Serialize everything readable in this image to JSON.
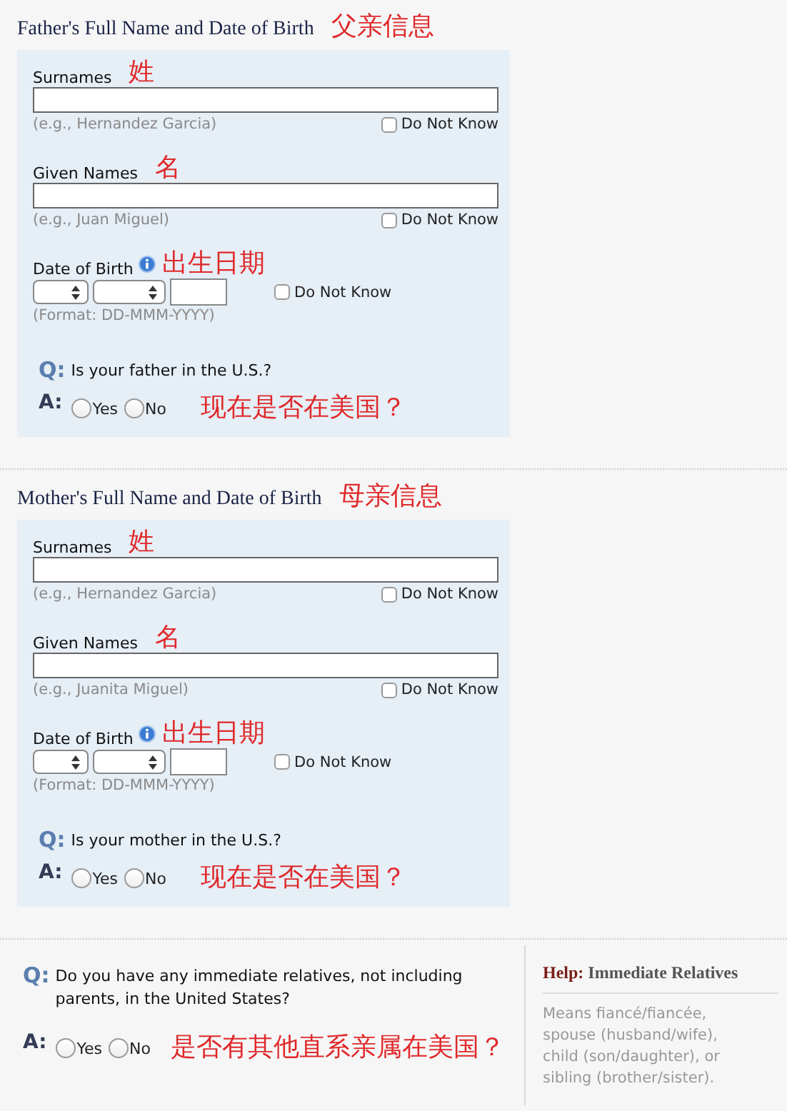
{
  "sections": [
    {
      "heading": "Father's Full Name and Date of Birth",
      "note": "父亲信息",
      "fields": [
        {
          "kind": "text",
          "label": "Surnames",
          "note": "姓",
          "hint": "(e.g., Hernandez Garcia)",
          "checkbox": {
            "label": "Do Not Know",
            "checked": false
          }
        },
        {
          "kind": "text",
          "label": "Given Names",
          "note": "名",
          "hint": "(e.g., Juan Miguel)",
          "checkbox": {
            "label": "Do Not Know",
            "checked": false
          }
        },
        {
          "kind": "date",
          "label": "Date of Birth",
          "note": "出生日期",
          "hint": "(Format: DD-MMM-YYYY)",
          "checkbox": {
            "label": "Do Not Know",
            "checked": false
          }
        }
      ],
      "question": {
        "q": "Q:",
        "text": "Is your father in the U.S.?",
        "a": "A:",
        "options": [
          {
            "label": "Yes",
            "selected": false
          },
          {
            "label": "No",
            "selected": false
          }
        ],
        "note": "现在是否在美国？"
      }
    },
    {
      "heading": "Mother's Full Name and Date of Birth",
      "note": "母亲信息",
      "fields": [
        {
          "kind": "text",
          "label": "Surnames",
          "note": "姓",
          "hint": "(e.g., Hernandez Garcia)",
          "checkbox": {
            "label": "Do Not Know",
            "checked": false
          }
        },
        {
          "kind": "text",
          "label": "Given Names",
          "note": "名",
          "hint": "(e.g., Juanita Miguel)",
          "checkbox": {
            "label": "Do Not Know",
            "checked": false
          }
        },
        {
          "kind": "date",
          "label": "Date of Birth",
          "note": "出生日期",
          "hint": "(Format: DD-MMM-YYYY)",
          "checkbox": {
            "label": "Do Not Know",
            "checked": false
          }
        }
      ],
      "question": {
        "q": "Q:",
        "text": "Is your mother in the U.S.?",
        "a": "A:",
        "options": [
          {
            "label": "Yes",
            "selected": false
          },
          {
            "label": "No",
            "selected": false
          }
        ],
        "note": "现在是否在美国？"
      }
    }
  ],
  "relatives": {
    "question": {
      "q": "Q:",
      "text": "Do you have any immediate relatives, not including parents, in the United States?",
      "a": "A:",
      "options": [
        {
          "label": "Yes",
          "selected": false
        },
        {
          "label": "No",
          "selected": false
        }
      ],
      "note": "是否有其他直系亲属在美国？"
    },
    "help": {
      "label": "Help:",
      "title": "Immediate Relatives",
      "text": "Means fiancé/fiancée, spouse (husband/wife), child (son/daughter), or sibling (brother/sister)."
    }
  }
}
